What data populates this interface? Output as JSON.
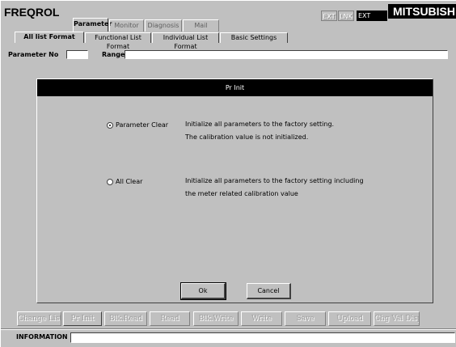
{
  "app": {
    "title": "FREQROL",
    "brand": "MITSUBISH"
  },
  "mode_indicators": [
    "EXT",
    "LNK",
    "EXT"
  ],
  "top_tabs": [
    {
      "label": "Parameter",
      "active": true
    },
    {
      "label": "Monitor",
      "active": false
    },
    {
      "label": "Diagnosis",
      "active": false
    },
    {
      "label": "Mail",
      "active": false
    }
  ],
  "sub_tabs": [
    {
      "label": "All list Format",
      "active": true
    },
    {
      "label": "Functional List Format",
      "active": false
    },
    {
      "label": "Individual List Format",
      "active": false
    },
    {
      "label": "Basic Settings",
      "active": false
    }
  ],
  "param_bar": {
    "param_no_label": "Parameter No",
    "param_no_value": "",
    "range_label": "Range",
    "range_value": ""
  },
  "dialog": {
    "title": "Pr Init",
    "options": [
      {
        "label": "Parameter Clear",
        "checked": true,
        "desc": [
          "Initialize all parameters to the factory setting.",
          "The calibration value is not initialized."
        ]
      },
      {
        "label": "All Clear",
        "checked": false,
        "desc": [
          "Initialize all parameters to the factory setting including",
          "the meter related calibration value"
        ]
      }
    ],
    "ok_label": "Ok",
    "cancel_label": "Cancel"
  },
  "toolbar": [
    "Change List",
    "Pr Init",
    "Blk.Read",
    "Read",
    "Blk.Write",
    "Write",
    "Save",
    "Upload",
    "Chg Val Disp"
  ],
  "info": {
    "label": "INFORMATION",
    "value": ""
  }
}
